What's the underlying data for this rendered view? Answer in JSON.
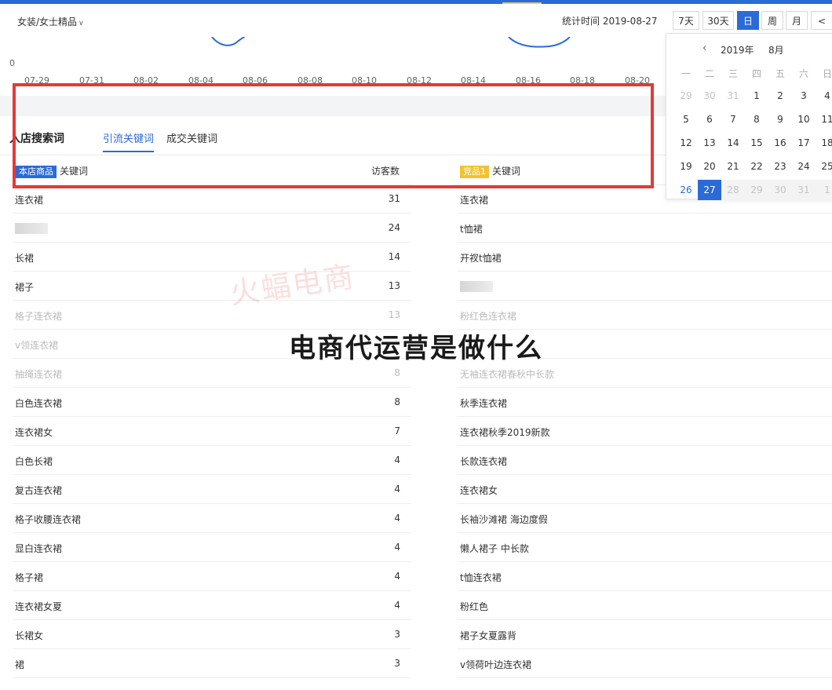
{
  "header": {
    "category": "女装/女士精品",
    "stat_time": "统计时间 2019-08-27",
    "periods": [
      "7天",
      "30天",
      "日",
      "周",
      "月",
      "<"
    ],
    "active_period": "日"
  },
  "chart": {
    "zero_label": "0",
    "x_ticks": [
      "07-29",
      "07-31",
      "08-02",
      "08-04",
      "08-06",
      "08-08",
      "08-10",
      "08-12",
      "08-14",
      "08-16",
      "08-18",
      "08-20"
    ]
  },
  "calendar": {
    "year": "2019年",
    "month": "8月",
    "weekdays": [
      "一",
      "二",
      "三",
      "四",
      "五",
      "六",
      "日"
    ],
    "weeks": [
      [
        "29",
        "30",
        "31",
        "1",
        "2",
        "3",
        "4"
      ],
      [
        "5",
        "6",
        "7",
        "8",
        "9",
        "10",
        "11"
      ],
      [
        "12",
        "13",
        "14",
        "15",
        "16",
        "17",
        "18"
      ],
      [
        "19",
        "20",
        "21",
        "22",
        "23",
        "24",
        "25"
      ],
      [
        "26",
        "27",
        "28",
        "29",
        "30",
        "31",
        "1"
      ]
    ],
    "selected": "27"
  },
  "panel": {
    "title": "入店搜索词",
    "tabs": [
      "引流关键词",
      "成交关键词"
    ],
    "active_tab": "引流关键词"
  },
  "left_table": {
    "badge": "本店商品",
    "col_keyword": "关键词",
    "col_visitors": "访客数",
    "rows": [
      {
        "kw": "连衣裙",
        "n": "31"
      },
      {
        "kw": "",
        "n": "24",
        "blurred": true
      },
      {
        "kw": "长裙",
        "n": "14"
      },
      {
        "kw": "裙子",
        "n": "13"
      },
      {
        "kw": "格子连衣裙",
        "n": "13",
        "faded": true
      },
      {
        "kw": "v领连衣裙",
        "n": "",
        "faded": true
      },
      {
        "kw": "抽绳连衣裙",
        "n": "8",
        "faded": true
      },
      {
        "kw": "白色连衣裙",
        "n": "8"
      },
      {
        "kw": "连衣裙女",
        "n": "7"
      },
      {
        "kw": "白色长裙",
        "n": "4"
      },
      {
        "kw": "复古连衣裙",
        "n": "4"
      },
      {
        "kw": "格子收腰连衣裙",
        "n": "4"
      },
      {
        "kw": "显白连衣裙",
        "n": "4"
      },
      {
        "kw": "格子裙",
        "n": "4"
      },
      {
        "kw": "连衣裙女夏",
        "n": "4"
      },
      {
        "kw": "长裙女",
        "n": "3"
      },
      {
        "kw": "裙",
        "n": "3"
      }
    ]
  },
  "right_table": {
    "badge": "竞品1",
    "col_keyword": "关键词",
    "rows": [
      {
        "kw": "连衣裙"
      },
      {
        "kw": "t恤裙"
      },
      {
        "kw": "开衩t恤裙"
      },
      {
        "kw": "",
        "blurred": true
      },
      {
        "kw": "粉红色连衣裙",
        "faded": true
      },
      {
        "kw": "",
        "faded": true
      },
      {
        "kw": "无袖连衣裙春秋中长款",
        "faded": true
      },
      {
        "kw": "秋季连衣裙"
      },
      {
        "kw": "连衣裙秋季2019新款"
      },
      {
        "kw": "长款连衣裙"
      },
      {
        "kw": "连衣裙女"
      },
      {
        "kw": "长袖沙滩裙 海边度假"
      },
      {
        "kw": "懒人裙子 中长款"
      },
      {
        "kw": "t恤连衣裙"
      },
      {
        "kw": "粉红色"
      },
      {
        "kw": "裙子女夏露背"
      },
      {
        "kw": "v领荷叶边连衣裙"
      }
    ]
  },
  "overlay": {
    "title": "电商代运营是做什么",
    "watermark": "火蝠电商"
  },
  "colors": {
    "accent": "#2a6bd8",
    "highlight_box": "#e53935",
    "competitor_badge": "#f2c230"
  }
}
